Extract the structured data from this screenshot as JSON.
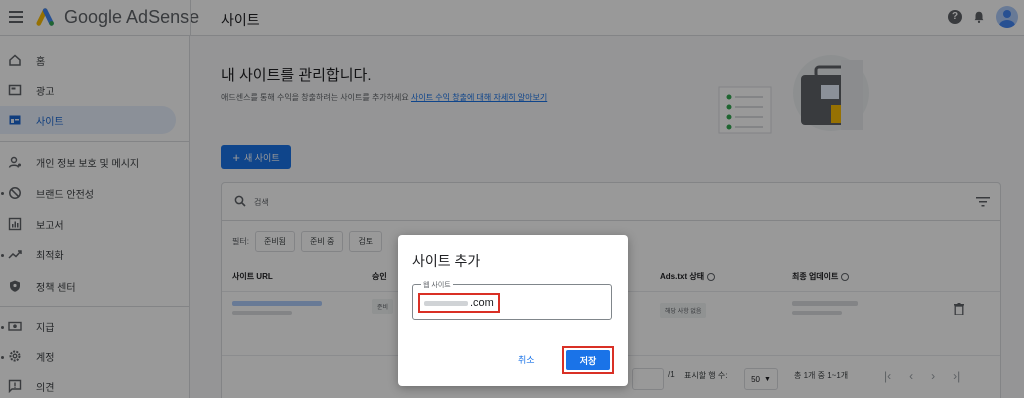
{
  "header": {
    "brand": "Google AdSense",
    "page_title": "사이트",
    "icons": [
      "menu-icon",
      "adsense-logo-icon",
      "help-icon",
      "bell-icon",
      "avatar"
    ]
  },
  "sidebar": {
    "items": [
      {
        "label": "홈",
        "icon": "home-icon"
      },
      {
        "label": "광고",
        "icon": "ads-icon"
      },
      {
        "label": "사이트",
        "icon": "sites-icon",
        "active": true
      },
      {
        "label": "개인 정보 보호 및 메시지",
        "icon": "privacy-icon"
      },
      {
        "label": "브랜드 안전성",
        "icon": "block-icon"
      },
      {
        "label": "보고서",
        "icon": "reports-icon"
      },
      {
        "label": "최적화",
        "icon": "trending-icon"
      },
      {
        "label": "정책 센터",
        "icon": "shield-icon"
      },
      {
        "label": "지급",
        "icon": "payments-icon"
      },
      {
        "label": "계정",
        "icon": "gear-icon"
      },
      {
        "label": "의견",
        "icon": "feedback-icon"
      }
    ]
  },
  "main": {
    "heading": "내 사이트를 관리합니다.",
    "subtext": "애드센스를 통해 수익을 창출하려는 사이트를 추가하세요",
    "subtext_link": "사이트 수익 창출에 대해 자세히 알아보기",
    "new_site_button": "새 사이트",
    "search_placeholder": "검색",
    "filter_label": "필터:",
    "filters": [
      "준비됨",
      "준비 중",
      "검토"
    ],
    "columns": {
      "site_url": "사이트 URL",
      "approval": "승인",
      "ads_txt": "Ads.txt 상태",
      "last_update": "최종 업데이트"
    },
    "row": {
      "approval_chip": "준비",
      "ads_txt_status": "해당 사항 없음"
    },
    "pager": {
      "page_of": "/1",
      "rows_label": "표시할 행 수:",
      "rows_value": "50",
      "range": "총 1개 중 1~1개"
    }
  },
  "dialog": {
    "title": "사이트 추가",
    "field_label": "웹 사이트",
    "field_value_suffix": ".com",
    "cancel_label": "취소",
    "save_label": "저장"
  },
  "colors": {
    "accent": "#1a73e8",
    "highlight": "#d93025"
  }
}
